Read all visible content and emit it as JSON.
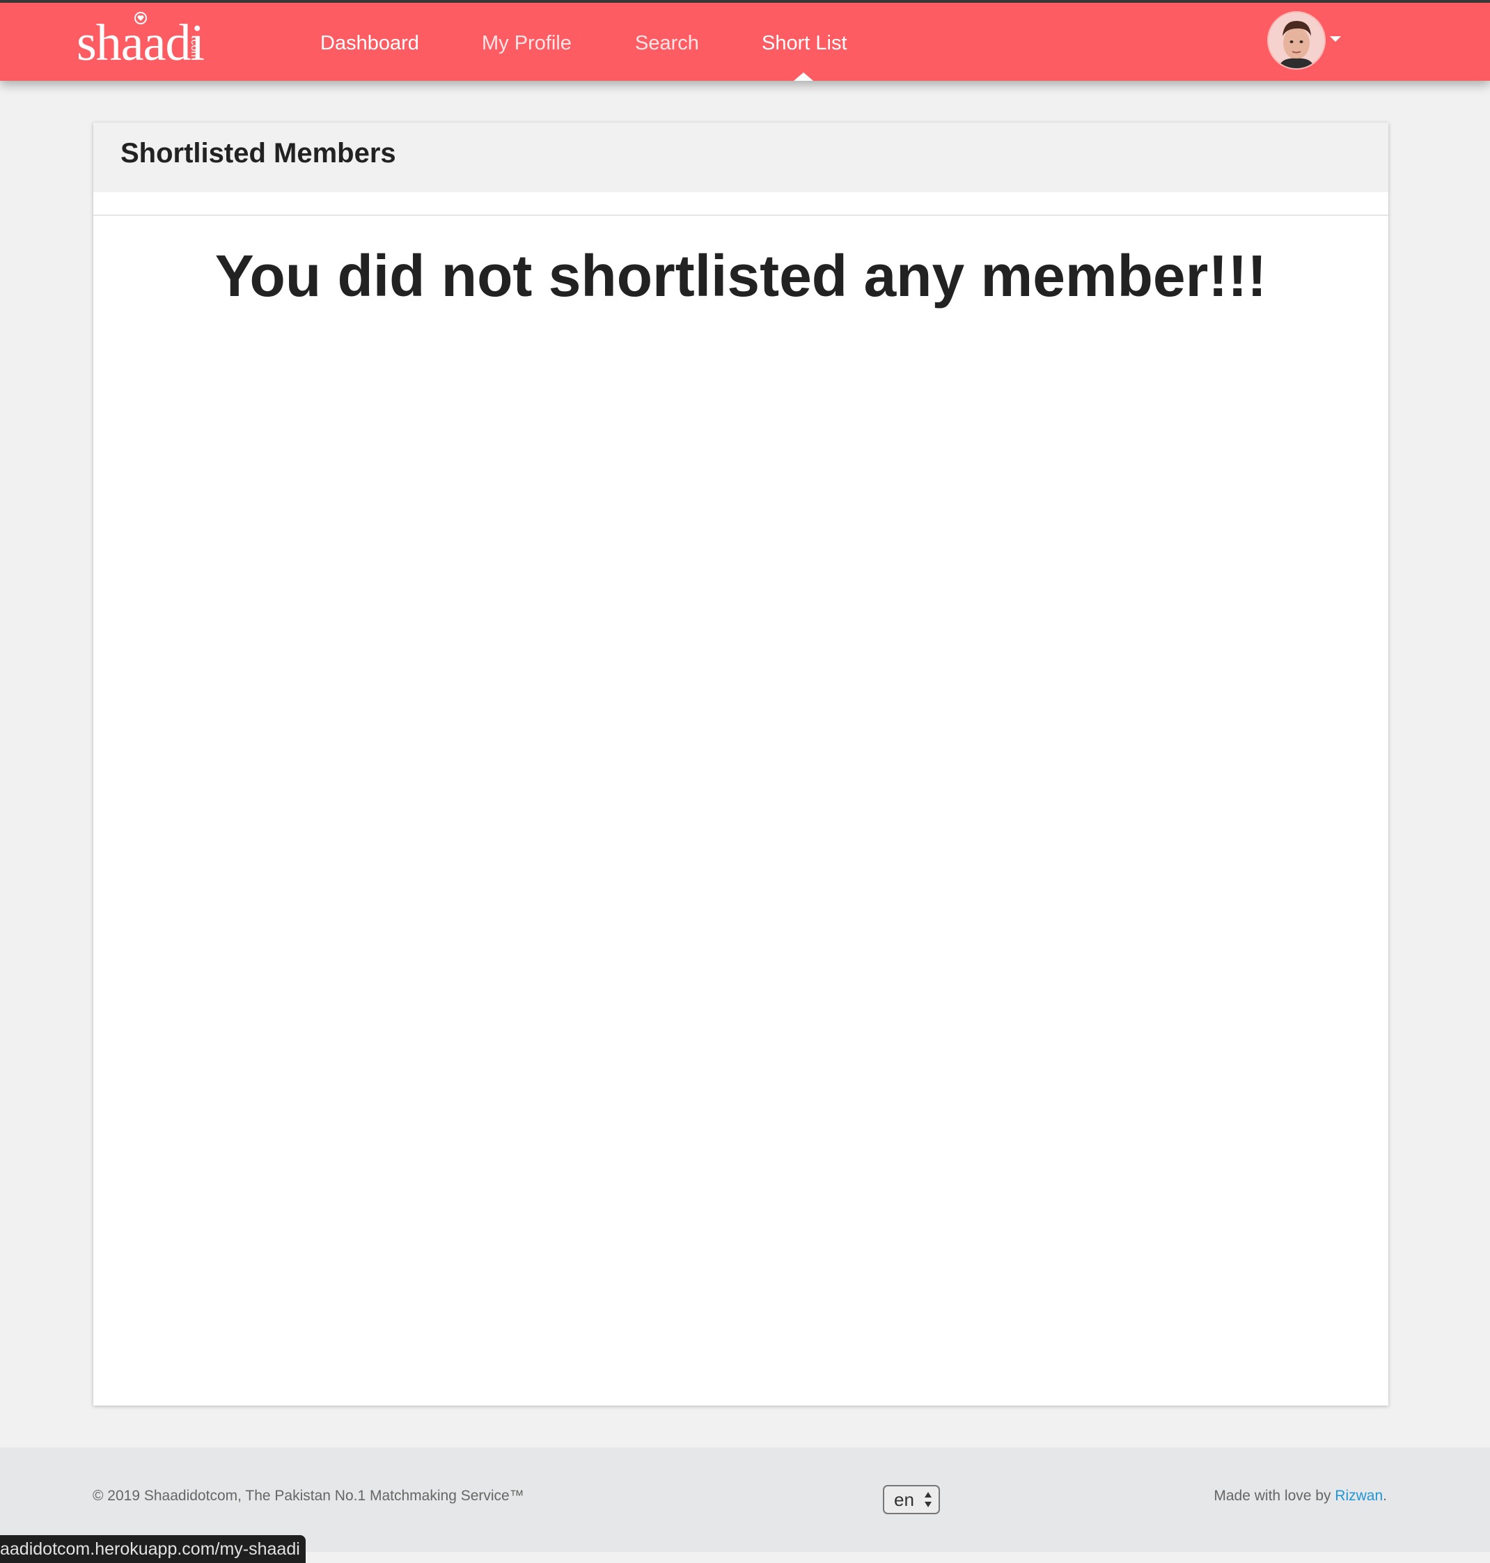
{
  "brand": {
    "logo_text": "shaadi",
    "logo_suffix": ".com",
    "accent_color": "#fd5c63"
  },
  "nav": {
    "items": [
      {
        "label": "Dashboard"
      },
      {
        "label": "My Profile"
      },
      {
        "label": "Search"
      },
      {
        "label": "Short List"
      }
    ],
    "active": "Short List"
  },
  "user": {
    "avatar_icon": "user-avatar"
  },
  "card": {
    "title": "Shortlisted Members",
    "empty_message": "You did not shortlisted any member!!!"
  },
  "footer": {
    "copyright": "© 2019 Shaadidotcom, The Pakistan No.1 Matchmaking Service™",
    "language": "en",
    "credit_prefix": "Made with love by ",
    "credit_name": "Rizwan",
    "credit_suffix": "."
  },
  "status_bar": {
    "url": "aadidotcom.herokuapp.com/my-shaadi"
  }
}
